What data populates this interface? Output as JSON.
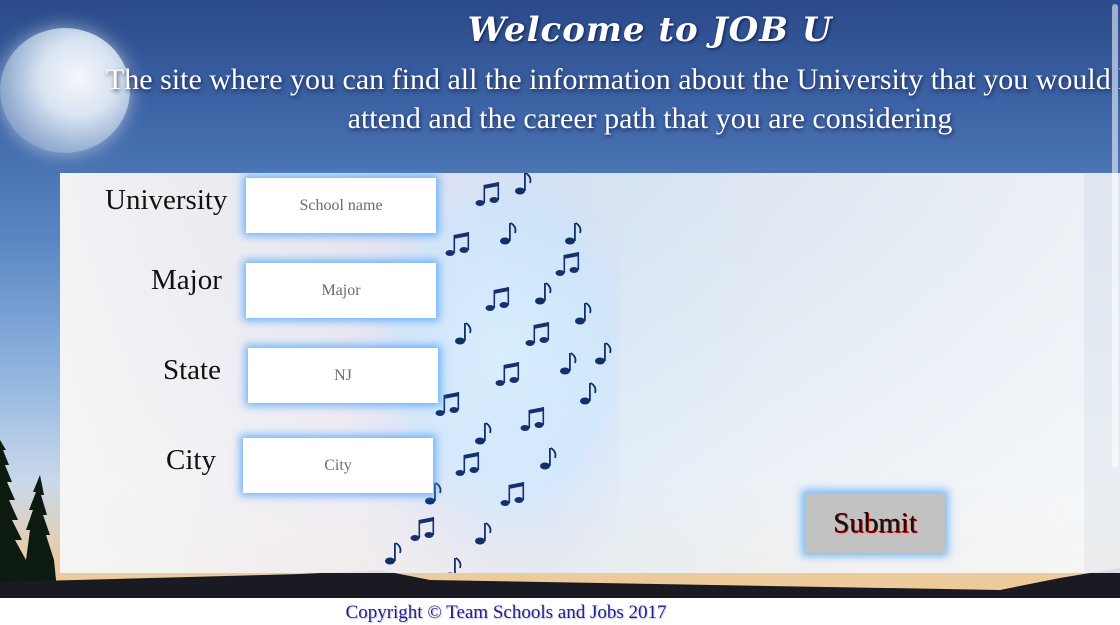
{
  "header": {
    "title": "Welcome to JOB U",
    "tagline": "The site where you can find all the information about the University that you would like to attend and the career path that you are considering"
  },
  "form": {
    "university": {
      "label": "University",
      "placeholder": "School name"
    },
    "major": {
      "label": "Major",
      "placeholder": "Major"
    },
    "state": {
      "label": "State",
      "placeholder": "NJ"
    },
    "city": {
      "label": "City",
      "placeholder": "City"
    },
    "submit_label": "Submit"
  },
  "footer": {
    "copyright": "Copyright © Team Schools and Jobs 2017"
  },
  "icons": {
    "moon": "moon-image",
    "notes": "music-notes-decoration",
    "trees": "tree-silhouette"
  },
  "colors": {
    "input_glow": "#46a0fa",
    "submit_bg": "#c2c2c2",
    "footer_text": "#1e1e8c"
  }
}
